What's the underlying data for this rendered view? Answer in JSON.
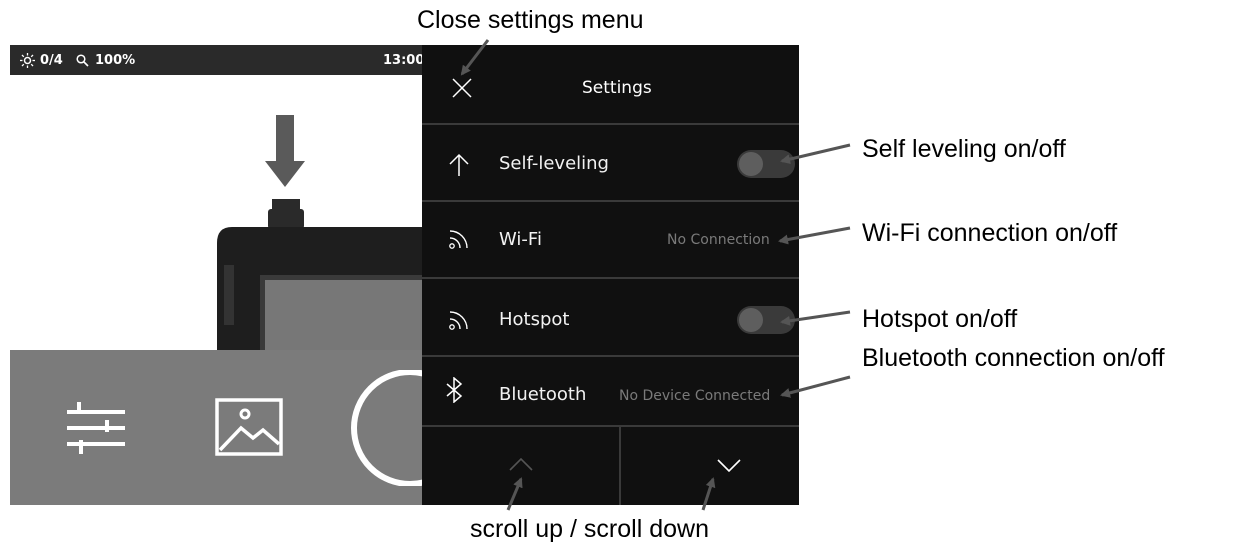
{
  "status_bar": {
    "brightness": "0/4",
    "zoom": "100%",
    "time": "13:00"
  },
  "settings": {
    "title": "Settings",
    "items": [
      {
        "label": "Self-leveling",
        "icon": "arrow-up-icon",
        "control": "toggle",
        "status": ""
      },
      {
        "label": "Wi-Fi",
        "icon": "wifi-icon",
        "control": "status",
        "status": "No Connection"
      },
      {
        "label": "Hotspot",
        "icon": "wifi-icon",
        "control": "toggle",
        "status": ""
      },
      {
        "label": "Bluetooth",
        "icon": "bluetooth-icon",
        "control": "status",
        "status": "No Device Connected"
      }
    ]
  },
  "annotations": {
    "close": "Close settings menu",
    "self_leveling": "Self leveling on/off",
    "wifi": "Wi-Fi connection on/off",
    "hotspot": "Hotspot on/off",
    "bluetooth": "Bluetooth connection on/off",
    "scroll": "scroll up / scroll down"
  },
  "colors": {
    "panel_bg": "#101010",
    "bottom_bar": "#7b7b7b",
    "status_bar": "#2a2a2a",
    "toggle_off": "#3a3a3a",
    "arrow": "#555555"
  }
}
